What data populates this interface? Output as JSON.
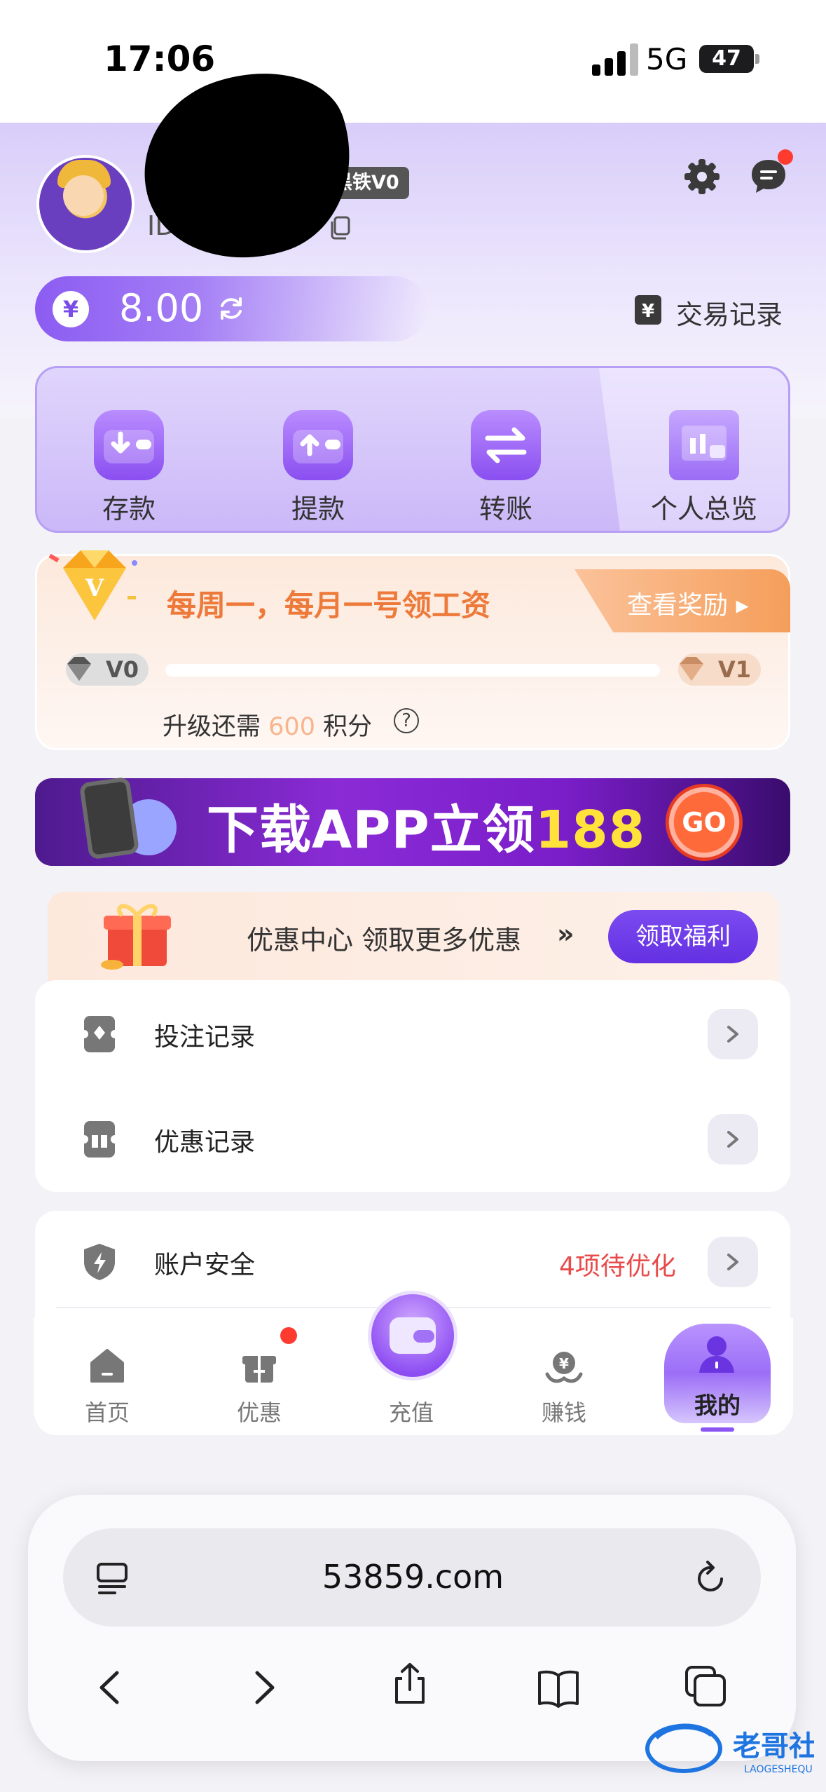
{
  "status_bar": {
    "time": "17:06",
    "network": "5G",
    "battery": "47"
  },
  "profile": {
    "vip_badge": "黑铁V0",
    "user_id": "ID ▇▇32050",
    "balance": "8.00",
    "currency_symbol": "¥",
    "transactions_label": "交易记录"
  },
  "quick_actions": [
    {
      "label": "存款"
    },
    {
      "label": "提款"
    },
    {
      "label": "转账"
    },
    {
      "label": "个人总览"
    }
  ],
  "vip_card": {
    "title": "每周一，每月一号领工资",
    "reward_link": "查看奖励",
    "current_level": "V0",
    "next_level": "V1",
    "upgrade_prefix": "升级还需",
    "upgrade_points": "600",
    "upgrade_suffix": "积分",
    "progress": 0.0
  },
  "banner": {
    "text_main": "下载APP立领",
    "text_number": "188",
    "go_label": "GO"
  },
  "promo": {
    "text": "优惠中心 领取更多优惠",
    "arrows": "»",
    "button": "领取福利"
  },
  "menu": {
    "bet_records": "投注记录",
    "promo_records": "优惠记录",
    "account_security": "账户安全",
    "security_alert": "4项待优化"
  },
  "tabbar": [
    {
      "label": "首页"
    },
    {
      "label": "优惠"
    },
    {
      "label": "充值"
    },
    {
      "label": "赚钱"
    },
    {
      "label": "我的"
    }
  ],
  "browser": {
    "url": "53859.com"
  },
  "colors": {
    "accent": "#8a55f3",
    "alert": "#e84b4b",
    "vip_orange": "#ed7a3a"
  }
}
